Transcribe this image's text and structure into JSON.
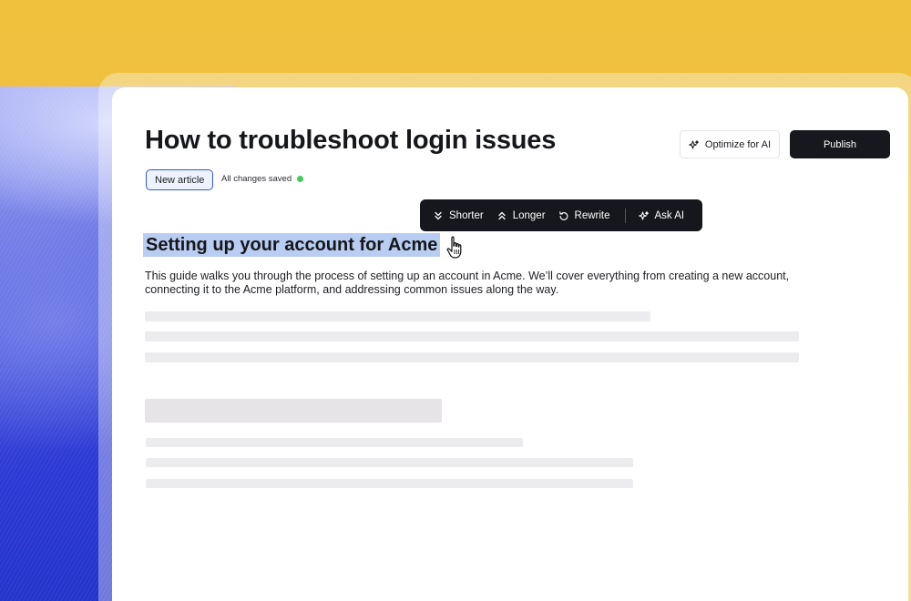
{
  "article": {
    "title": "How to troubleshoot login issues",
    "badge": "New article",
    "save_status": "All changes saved",
    "selected_heading": "Setting up your account for Acme",
    "body_text": "This guide walks you through the process of setting up an account in Acme. We’ll cover everything from creating a new account, connecting it to the Acme platform, and addressing common issues along the way."
  },
  "actions": {
    "optimize_label": "Optimize for AI",
    "publish_label": "Publish"
  },
  "ai_toolbar": {
    "shorter": "Shorter",
    "longer": "Longer",
    "rewrite": "Rewrite",
    "ask_ai": "Ask AI"
  },
  "icons": {
    "optimize": "sparkle-icon",
    "shorter": "chevrons-down-icon",
    "longer": "chevrons-up-icon",
    "rewrite": "rotate-ccw-icon",
    "ask_ai": "sparkle-icon",
    "cursor": "hand-pointer-icon"
  },
  "colors": {
    "selection": "#b8cdf1",
    "status_dot": "#3ecf5a",
    "primary_button": "#17181d",
    "badge_border": "#3458c6"
  }
}
